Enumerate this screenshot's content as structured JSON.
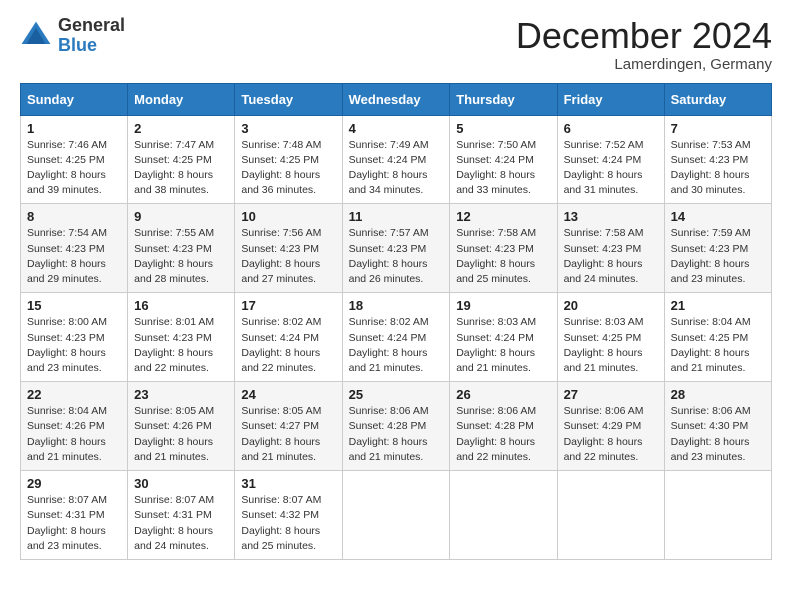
{
  "header": {
    "logo_general": "General",
    "logo_blue": "Blue",
    "month_title": "December 2024",
    "location": "Lamerdingen, Germany"
  },
  "calendar": {
    "headers": [
      "Sunday",
      "Monday",
      "Tuesday",
      "Wednesday",
      "Thursday",
      "Friday",
      "Saturday"
    ],
    "weeks": [
      [
        {
          "day": "1",
          "info": "Sunrise: 7:46 AM\nSunset: 4:25 PM\nDaylight: 8 hours\nand 39 minutes."
        },
        {
          "day": "2",
          "info": "Sunrise: 7:47 AM\nSunset: 4:25 PM\nDaylight: 8 hours\nand 38 minutes."
        },
        {
          "day": "3",
          "info": "Sunrise: 7:48 AM\nSunset: 4:25 PM\nDaylight: 8 hours\nand 36 minutes."
        },
        {
          "day": "4",
          "info": "Sunrise: 7:49 AM\nSunset: 4:24 PM\nDaylight: 8 hours\nand 34 minutes."
        },
        {
          "day": "5",
          "info": "Sunrise: 7:50 AM\nSunset: 4:24 PM\nDaylight: 8 hours\nand 33 minutes."
        },
        {
          "day": "6",
          "info": "Sunrise: 7:52 AM\nSunset: 4:24 PM\nDaylight: 8 hours\nand 31 minutes."
        },
        {
          "day": "7",
          "info": "Sunrise: 7:53 AM\nSunset: 4:23 PM\nDaylight: 8 hours\nand 30 minutes."
        }
      ],
      [
        {
          "day": "8",
          "info": "Sunrise: 7:54 AM\nSunset: 4:23 PM\nDaylight: 8 hours\nand 29 minutes."
        },
        {
          "day": "9",
          "info": "Sunrise: 7:55 AM\nSunset: 4:23 PM\nDaylight: 8 hours\nand 28 minutes."
        },
        {
          "day": "10",
          "info": "Sunrise: 7:56 AM\nSunset: 4:23 PM\nDaylight: 8 hours\nand 27 minutes."
        },
        {
          "day": "11",
          "info": "Sunrise: 7:57 AM\nSunset: 4:23 PM\nDaylight: 8 hours\nand 26 minutes."
        },
        {
          "day": "12",
          "info": "Sunrise: 7:58 AM\nSunset: 4:23 PM\nDaylight: 8 hours\nand 25 minutes."
        },
        {
          "day": "13",
          "info": "Sunrise: 7:58 AM\nSunset: 4:23 PM\nDaylight: 8 hours\nand 24 minutes."
        },
        {
          "day": "14",
          "info": "Sunrise: 7:59 AM\nSunset: 4:23 PM\nDaylight: 8 hours\nand 23 minutes."
        }
      ],
      [
        {
          "day": "15",
          "info": "Sunrise: 8:00 AM\nSunset: 4:23 PM\nDaylight: 8 hours\nand 23 minutes."
        },
        {
          "day": "16",
          "info": "Sunrise: 8:01 AM\nSunset: 4:23 PM\nDaylight: 8 hours\nand 22 minutes."
        },
        {
          "day": "17",
          "info": "Sunrise: 8:02 AM\nSunset: 4:24 PM\nDaylight: 8 hours\nand 22 minutes."
        },
        {
          "day": "18",
          "info": "Sunrise: 8:02 AM\nSunset: 4:24 PM\nDaylight: 8 hours\nand 21 minutes."
        },
        {
          "day": "19",
          "info": "Sunrise: 8:03 AM\nSunset: 4:24 PM\nDaylight: 8 hours\nand 21 minutes."
        },
        {
          "day": "20",
          "info": "Sunrise: 8:03 AM\nSunset: 4:25 PM\nDaylight: 8 hours\nand 21 minutes."
        },
        {
          "day": "21",
          "info": "Sunrise: 8:04 AM\nSunset: 4:25 PM\nDaylight: 8 hours\nand 21 minutes."
        }
      ],
      [
        {
          "day": "22",
          "info": "Sunrise: 8:04 AM\nSunset: 4:26 PM\nDaylight: 8 hours\nand 21 minutes."
        },
        {
          "day": "23",
          "info": "Sunrise: 8:05 AM\nSunset: 4:26 PM\nDaylight: 8 hours\nand 21 minutes."
        },
        {
          "day": "24",
          "info": "Sunrise: 8:05 AM\nSunset: 4:27 PM\nDaylight: 8 hours\nand 21 minutes."
        },
        {
          "day": "25",
          "info": "Sunrise: 8:06 AM\nSunset: 4:28 PM\nDaylight: 8 hours\nand 21 minutes."
        },
        {
          "day": "26",
          "info": "Sunrise: 8:06 AM\nSunset: 4:28 PM\nDaylight: 8 hours\nand 22 minutes."
        },
        {
          "day": "27",
          "info": "Sunrise: 8:06 AM\nSunset: 4:29 PM\nDaylight: 8 hours\nand 22 minutes."
        },
        {
          "day": "28",
          "info": "Sunrise: 8:06 AM\nSunset: 4:30 PM\nDaylight: 8 hours\nand 23 minutes."
        }
      ],
      [
        {
          "day": "29",
          "info": "Sunrise: 8:07 AM\nSunset: 4:31 PM\nDaylight: 8 hours\nand 23 minutes."
        },
        {
          "day": "30",
          "info": "Sunrise: 8:07 AM\nSunset: 4:31 PM\nDaylight: 8 hours\nand 24 minutes."
        },
        {
          "day": "31",
          "info": "Sunrise: 8:07 AM\nSunset: 4:32 PM\nDaylight: 8 hours\nand 25 minutes."
        },
        null,
        null,
        null,
        null
      ]
    ]
  }
}
